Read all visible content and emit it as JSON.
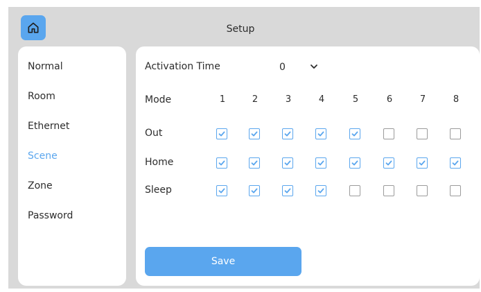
{
  "header": {
    "title": "Setup",
    "home_icon": "home-icon"
  },
  "sidebar": {
    "items": [
      {
        "label": "Normal",
        "active": false
      },
      {
        "label": "Room",
        "active": false
      },
      {
        "label": "Ethernet",
        "active": false
      },
      {
        "label": "Scene",
        "active": true
      },
      {
        "label": "Zone",
        "active": false
      },
      {
        "label": "Password",
        "active": false
      }
    ]
  },
  "activation": {
    "label": "Activation Time",
    "value": "0",
    "dropdown_icon": "chevron-down-icon"
  },
  "mode": {
    "label": "Mode",
    "columns": [
      "1",
      "2",
      "3",
      "4",
      "5",
      "6",
      "7",
      "8"
    ],
    "rows": [
      {
        "label": "Out",
        "checks": [
          true,
          true,
          true,
          true,
          true,
          false,
          false,
          false
        ]
      },
      {
        "label": "Home",
        "checks": [
          true,
          true,
          true,
          true,
          true,
          true,
          true,
          true
        ]
      },
      {
        "label": "Sleep",
        "checks": [
          true,
          true,
          true,
          true,
          false,
          false,
          false,
          false
        ]
      }
    ]
  },
  "save_label": "Save",
  "colors": {
    "accent": "#5aa6ee",
    "frame": "#d9d9d9",
    "panel": "#ffffff"
  }
}
